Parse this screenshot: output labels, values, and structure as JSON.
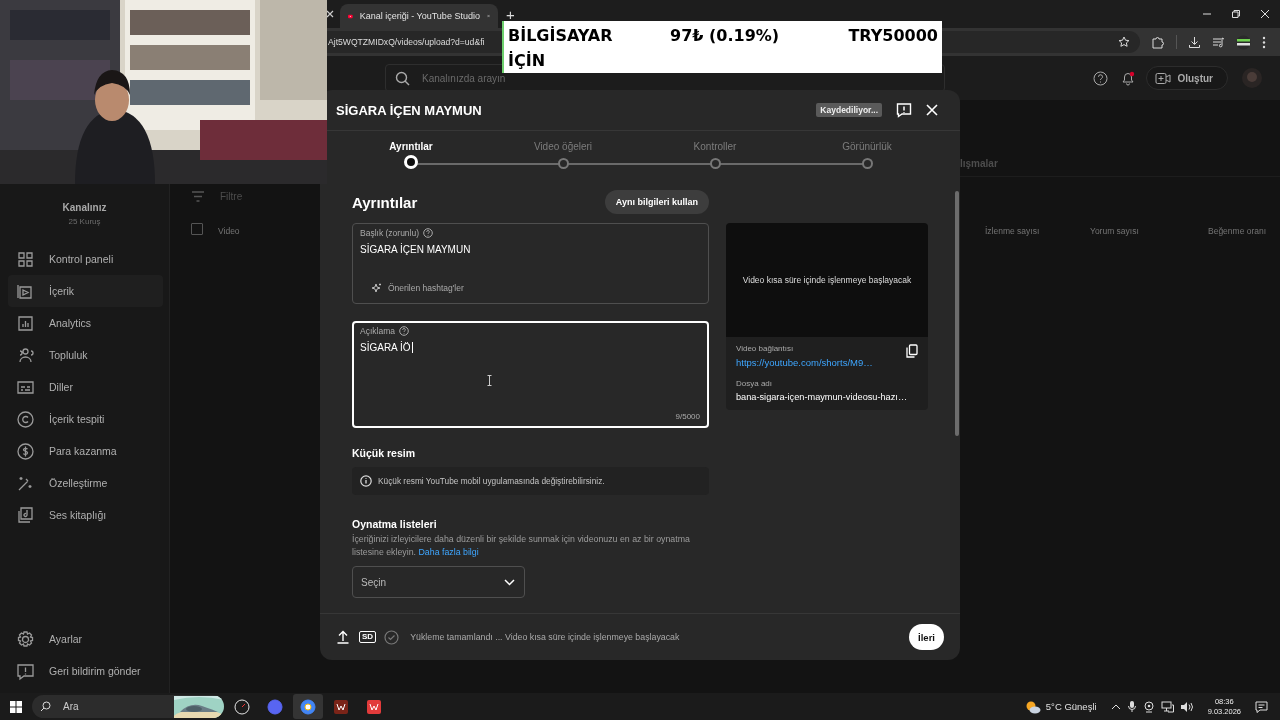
{
  "browser": {
    "tabs": [
      {
        "title": "Kanal içeriği - YouTube Studio",
        "selected": true
      }
    ],
    "new_tab": "+",
    "url": "Ajt5WQTZMIDxQ/videos/upload?d=ud&fi"
  },
  "studio_header": {
    "search": {
      "placeholder": "Kanalınızda arayın"
    },
    "create_button": "Oluştur",
    "notifications_unread": true
  },
  "sidebar": {
    "channel_name": "Kanalınız",
    "channel_subtitle": "25 Kuruş",
    "items": [
      {
        "label": "Kontrol paneli",
        "selected": false
      },
      {
        "label": "İçerik",
        "selected": true
      },
      {
        "label": "Analytics",
        "selected": false
      },
      {
        "label": "Topluluk",
        "selected": false
      },
      {
        "label": "Diller",
        "selected": false
      },
      {
        "label": "İçerik tespiti",
        "selected": false
      },
      {
        "label": "Para kazanma",
        "selected": false
      },
      {
        "label": "Özelleştirme",
        "selected": false
      },
      {
        "label": "Ses kitaplığı",
        "selected": false
      }
    ],
    "footer_items": [
      {
        "label": "Ayarlar"
      },
      {
        "label": "Geri bildirim gönder"
      }
    ]
  },
  "content": {
    "tab_partial": "lışmalar",
    "select_all_checked": false,
    "filter_placeholder": "Filtre",
    "columns": [
      "Video",
      "İzlenme sayısı",
      "Yorum sayısı",
      "Beğenme oranı"
    ]
  },
  "dialog": {
    "title": "SİGARA İÇEN MAYMUN",
    "save_status": "Kaydediliyor...",
    "steps": [
      {
        "label": "Ayrıntılar",
        "selected": true
      },
      {
        "label": "Video öğeleri",
        "selected": false
      },
      {
        "label": "Kontroller",
        "selected": false
      },
      {
        "label": "Görünürlük",
        "selected": false
      }
    ],
    "section_title": "Ayrıntılar",
    "reuse_button": "Aynı bilgileri kullan",
    "title_field": {
      "label": "Başlık (zorunlu)",
      "value": "SİGARA İÇEN MAYMUN",
      "hashtags": "Önerilen hashtag'ler",
      "focused": false
    },
    "description_field": {
      "label": "Açıklama",
      "value": "SİGARA İÖ",
      "counter": "9/5000",
      "focused": true
    },
    "preview": {
      "message": "Video kısa süre içinde işlenmeye başlayacak",
      "link_label": "Video bağlantısı",
      "link": "https://youtube.com/shorts/M9…",
      "file_label": "Dosya adı",
      "file_name": "bana-sigara-içen-maymun-videosu-hazı…"
    },
    "thumbnail": {
      "title": "Küçük resim",
      "info": "Küçük resmi YouTube mobil uygulamasında değiştirebilirsiniz."
    },
    "playlists": {
      "title": "Oynatma listeleri",
      "text": "İçeriğinizi izleyicilere daha düzenli bir şekilde sunmak için videonuzu en az bir oynatma listesine ekleyin.",
      "link": "Daha fazla bilgi",
      "select_placeholder": "Seçin"
    },
    "footer": {
      "quality_badge": "SD",
      "status": "Yükleme tamamlandı ... Video kısa süre içinde işlenmeye başlayacak",
      "next_button": "İleri"
    }
  },
  "ticker": {
    "name": "BİLGİSAYAR İÇİN",
    "change": "97₺ (0.19%)",
    "price": "TRY50000"
  },
  "taskbar": {
    "search": "Ara",
    "apps": [
      {
        "selected": false
      },
      {
        "selected": false
      },
      {
        "selected": true
      },
      {
        "selected": false
      },
      {
        "selected": false
      }
    ],
    "weather": "5°C Güneşli",
    "time": "08:36",
    "date": "9.03.2026"
  }
}
